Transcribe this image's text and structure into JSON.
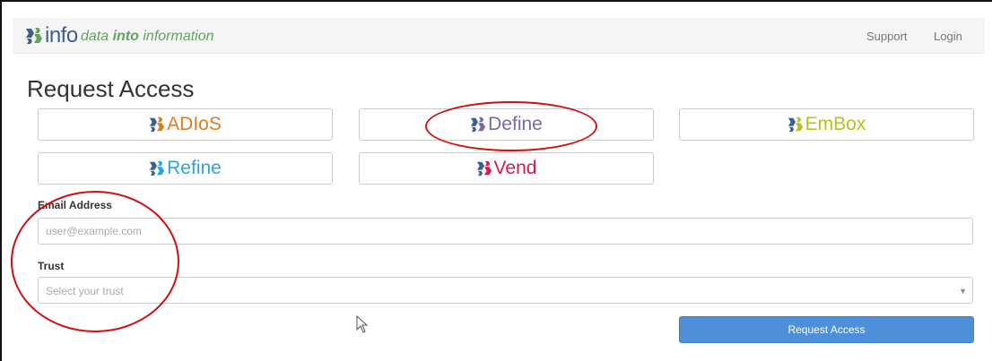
{
  "navbar": {
    "brand": "info",
    "tagline_pre": "data ",
    "tagline_bold": "into",
    "tagline_post": " information",
    "links": [
      "Support",
      "Login"
    ]
  },
  "page_title": "Request Access",
  "apps": [
    {
      "name": "ADIoS",
      "color": "#e07a1f"
    },
    {
      "name": "Define",
      "color": "#7a68a8"
    },
    {
      "name": "EmBox",
      "color": "#b8c21c"
    },
    {
      "name": "Refine",
      "color": "#2aa5d6"
    },
    {
      "name": "Vend",
      "color": "#d6184a"
    }
  ],
  "form": {
    "email_label": "Email Address",
    "email_placeholder": "user@example.com",
    "trust_label": "Trust",
    "trust_placeholder": "Select your trust",
    "submit_label": "Request Access"
  },
  "colors": {
    "annotation": "#d01010",
    "primary_button": "#4d8fd8",
    "logo_blue": "#3b5f8f",
    "logo_green": "#5fa35f"
  },
  "icons": [
    "logo-mark-icon",
    "caret-down-icon",
    "mouse-pointer-icon"
  ]
}
